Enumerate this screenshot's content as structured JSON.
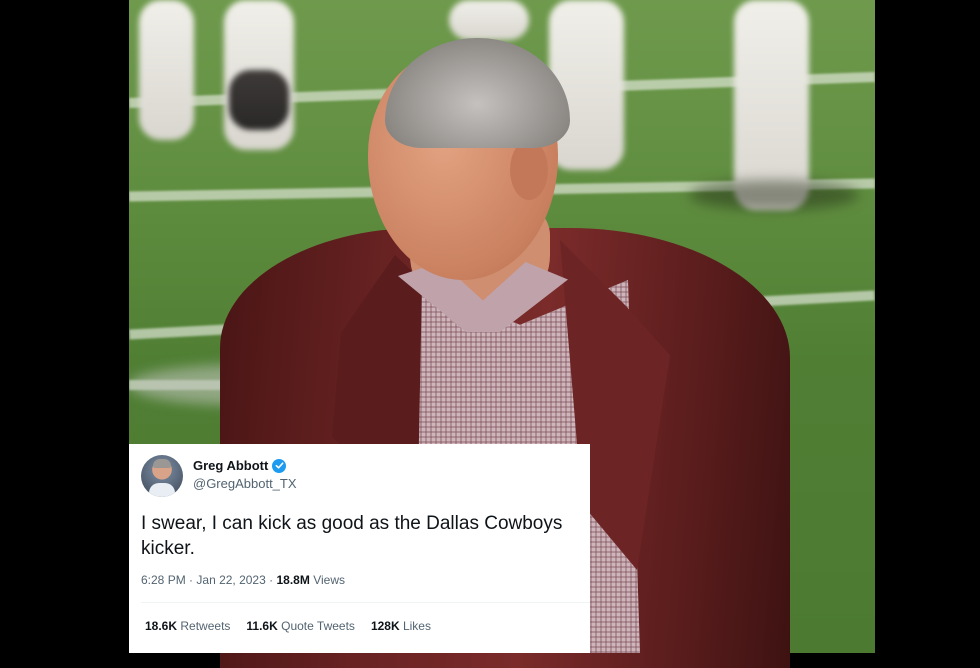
{
  "tweet": {
    "display_name": "Greg Abbott",
    "verified_icon": "verified-badge-icon",
    "handle": "@GregAbbott_TX",
    "text": "I swear, I can kick as good as the Dallas Cowboys kicker.",
    "time": "6:28 PM",
    "separator": "·",
    "date": "Jan 22, 2023",
    "views_count": "18.8M",
    "views_label": "Views",
    "retweets_count": "18.6K",
    "retweets_label": "Retweets",
    "quote_tweets_count": "11.6K",
    "quote_tweets_label": "Quote Tweets",
    "likes_count": "128K",
    "likes_label": "Likes",
    "verified_color": "#1d9bf0"
  }
}
